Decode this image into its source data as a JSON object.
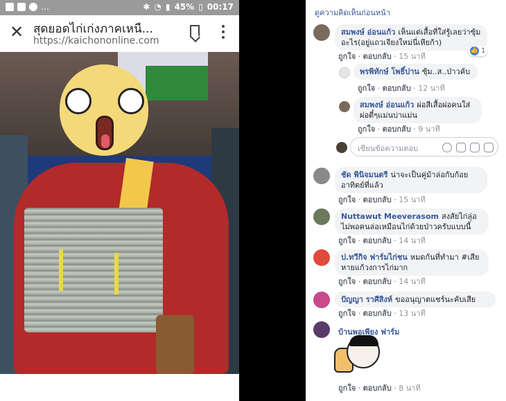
{
  "status_bar": {
    "battery": "45%",
    "time": "00:17"
  },
  "browser": {
    "title": "สุดยอดไก่เก่งภาคเหนื...",
    "url": "https://kaichononline.com"
  },
  "comments_panel": {
    "view_previous": "ดูความคิดเห็นก่อนหน้า",
    "like_label": "ถูกใจ",
    "reply_label": "ตอบกลับ",
    "reply_placeholder": "เขียนข้อความตอบ",
    "comments": [
      {
        "name": "สมพงษ์ อ่อนแก้ว",
        "text": "เห็นแต่เสื้อที่ใส่รู้เลยว่าซุ้มอะไร(อยู่แถวเจียงใหม่นี่เหียก้า)",
        "time": "15 นาที",
        "reactions": "1"
      },
      {
        "name": "พรพิทักษ์ โพธิ์ปาน",
        "text": "ซุ้ม..ส..ป่าวคับ",
        "time": "12 นาที"
      },
      {
        "name": "สมพงษ์ อ่อนแก้ว",
        "text": "ผ่อสีเสื้อผ่อคนใส่ผ่อตี๋ๆแม่นบ่าแม่น",
        "time": "9 นาที"
      },
      {
        "name": "ชัด พินิจมนตรี",
        "text": "น่าจะเป็นคู่ม้าล่อกับก้อยอาทิตย์ที่แล้ว",
        "time": "15 นาที"
      },
      {
        "name": "Nuttawut Meeverasom",
        "text": "สงสัยไก่ลุ่อไม่พอคนล่อเหมือนไก่ด้วยป่าวครับแบบนี้",
        "time": "14 นาที"
      },
      {
        "name": "ป.ทวีกิจ ฟาร์มไก่ชน",
        "text": "หมดกันที่ทำมา #เสียหายแก้วงการไก่มาก",
        "time": "14 นาที"
      },
      {
        "name": "ปัญญา ราศีสิงห์",
        "text": "ขออนุญาตแชร์นะคับเสีย",
        "time": "13 นาที"
      },
      {
        "name": "บ้านพอเพียง ฟาร์ม",
        "text": "",
        "time": "8 นาที"
      }
    ]
  }
}
